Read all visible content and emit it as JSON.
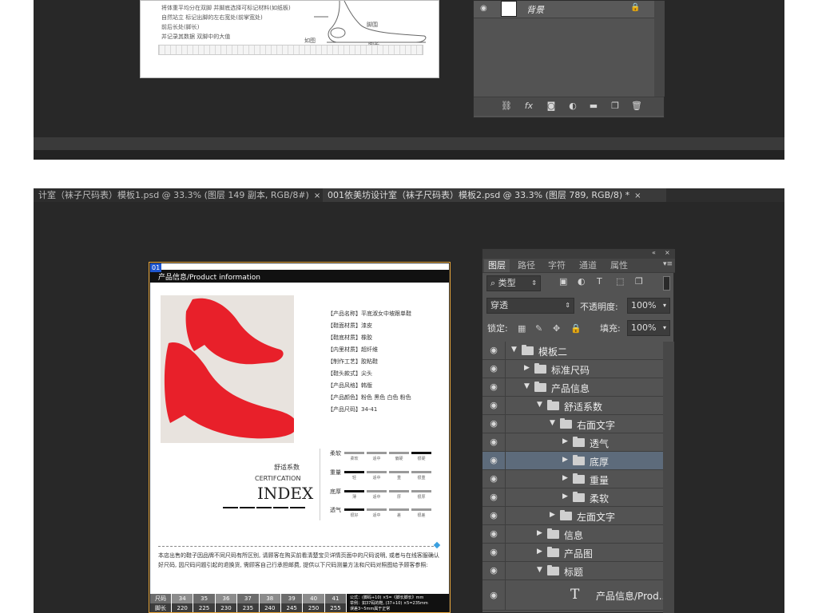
{
  "top_window": {
    "guide_lines": [
      "将体重平均分在双脚 并脚底选择可标记材料(如纸板)",
      "自然站立 标记出脚的左右宽处(前掌宽处)",
      "前后长处(脚长)",
      "并记录其数据 双脚中的大值"
    ],
    "diagram_labels": [
      "脚围",
      "如图",
      "脚长"
    ],
    "background_layer": "背景",
    "icons": [
      "eye-icon",
      "link-icon",
      "fx-icon",
      "mask-icon",
      "adjustment-icon",
      "folder-icon",
      "new-layer-icon",
      "trash-icon",
      "lock-icon"
    ]
  },
  "tabs": [
    {
      "label": "计室（袜子尺码表）模板1.psd @ 33.3% (图层 149 副本, RGB/8#)",
      "close": "×"
    },
    {
      "label": "001依美坊设计室（袜子尺码表）模板2.psd @ 33.3% (图层 789, RGB/8) *",
      "close": "×"
    }
  ],
  "document": {
    "badge": "01",
    "header": "产品信息/Product information",
    "specs": [
      "【产品名称】平底淑女中坡跟单鞋",
      "【鞋面材质】漆皮",
      "【鞋底材质】橡胶",
      "【内里材质】超纤维",
      "【制作工艺】胶粘鞋",
      "【鞋头款式】尖头",
      "【产品风格】韩版",
      "【产品颜色】粉色 黑色 白色 粉色",
      "【产品尺码】34-41"
    ],
    "shoe_color": "#e8202a",
    "cert_cn": "舒适系数",
    "cert_en": "CERTIFCATION",
    "cert_index": "INDEX",
    "metrics": [
      {
        "label": "柔软",
        "levels": [
          "柔软",
          "适中",
          "偏硬",
          "很硬"
        ],
        "active": 3
      },
      {
        "label": "重量",
        "levels": [
          "轻",
          "适中",
          "重",
          "很重"
        ],
        "active": 0
      },
      {
        "label": "底厚",
        "levels": [
          "薄",
          "适中",
          "厚",
          "很厚"
        ],
        "active": 0
      },
      {
        "label": "透气",
        "levels": [
          "很好",
          "适中",
          "差",
          "很差"
        ],
        "active": 0
      }
    ],
    "paragraph": "本店出售的鞋子因品牌不同尺码有所区别, 请顾客在购买前看清楚宝贝详情页面中的尺码说明, 或者与在线客服确认好尺码, 因尺码问题引起的退换货, 需顾客自己行承担邮费, 提供以下尺码测量方法和尺码对照图给予顾客参照:",
    "size_table": {
      "row1": [
        "尺码",
        "34",
        "35",
        "36",
        "37",
        "38",
        "39",
        "40",
        "41"
      ],
      "row2": [
        "脚长",
        "220",
        "225",
        "230",
        "235",
        "240",
        "245",
        "250",
        "255"
      ],
      "note": [
        "公式：(脚码+10) ×5=《脚长脚长》mm",
        "举例：如37码的鞋, (37+10) ×5=235mm",
        "误差3~5mm属于正常"
      ]
    }
  },
  "panel": {
    "tabs": [
      "图层",
      "路径",
      "字符",
      "通道",
      "属性"
    ],
    "active_tab": 0,
    "filter": "类型",
    "blend": "穿透",
    "opacity_label": "不透明度:",
    "opacity": "100%",
    "lock_label": "锁定:",
    "fill_label": "填充:",
    "fill": "100%",
    "layers": [
      {
        "name": "模板二",
        "depth": 0,
        "open": true,
        "type": "folder"
      },
      {
        "name": "标准尺码",
        "depth": 1,
        "open": false,
        "type": "folder"
      },
      {
        "name": "产品信息",
        "depth": 1,
        "open": true,
        "type": "folder"
      },
      {
        "name": "舒适系数",
        "depth": 2,
        "open": true,
        "type": "folder"
      },
      {
        "name": "右面文字",
        "depth": 3,
        "open": true,
        "type": "folder"
      },
      {
        "name": "透气",
        "depth": 4,
        "open": false,
        "type": "folder"
      },
      {
        "name": "底厚",
        "depth": 4,
        "open": false,
        "type": "folder",
        "selected": true
      },
      {
        "name": "重量",
        "depth": 4,
        "open": false,
        "type": "folder"
      },
      {
        "name": "柔软",
        "depth": 4,
        "open": false,
        "type": "folder"
      },
      {
        "name": "左面文字",
        "depth": 3,
        "open": false,
        "type": "folder"
      },
      {
        "name": "信息",
        "depth": 2,
        "open": false,
        "type": "folder"
      },
      {
        "name": "产品图",
        "depth": 2,
        "open": false,
        "type": "folder"
      },
      {
        "name": "标题",
        "depth": 2,
        "open": true,
        "type": "folder"
      },
      {
        "name": "产品信息/Prod...",
        "depth": 3,
        "open": false,
        "type": "text"
      }
    ]
  }
}
